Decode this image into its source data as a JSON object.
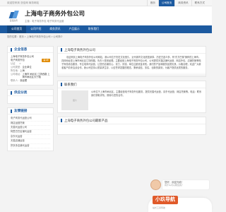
{
  "topbar": {
    "welcome": "欢迎您来到 亚佳网 商务网站",
    "links": [
      "首页",
      "公司首页",
      "商务资讯",
      "联系方式"
    ]
  },
  "header": {
    "logo_caption": "亚佳商务",
    "company_name": "上海电子商务外包公司",
    "company_sub": "主营：电子商务外包·电子商务代运营"
  },
  "nav": [
    "公司首页",
    "公司介绍",
    "商务资讯",
    "产品展示",
    "联系我们"
  ],
  "breadcrumb": "您的位置：首页 > 上海电子商务外包公司 > 公司简介",
  "sidebar": {
    "info_title": "企业信息",
    "info_rows": [
      {
        "k": "",
        "v": "上海电子商务外包公司"
      },
      {
        "k": "",
        "v": "电子商务外包",
        "badge": "第1年"
      },
      {
        "k": "认证",
        "v": "☆"
      },
      {
        "k": "公司类型：",
        "v": "企业单位"
      },
      {
        "k": "所在地：",
        "v": "上海"
      },
      {
        "k": "公司地址：",
        "v": "上海市 闸北区 江场西路 上海市闸北区大宁路"
      },
      {
        "k": "联系人：",
        "v": "张经理"
      }
    ],
    "recent_title": "供应分类",
    "news_title": "友情链接",
    "news": [
      "电子商务代运营公司",
      "网店运营托管",
      "天猫代运营公司",
      "阿里巴巴店铺代运营",
      "京东代运营",
      "天猫店铺运营",
      "拼多多店铺代运营"
    ]
  },
  "main": {
    "intro_title": "上海电子商务外包公司",
    "intro_text": "欢迎来到上海电子商务外包公司网站，我公司位于历史文化悠久、近代城市文化底蕴深厚、历史古迹众多，有“东方巴黎”美称的上海市。具体地址是上海市闸北区江场西路，负责人是张经理。主要经营上海电子商务外包公司，公司提供天猫店铺代运营、网店外包、店铺托管等电子商务综合服务，专注电商代运营，让您的店铺省心、省力、省钱。单位注册资金未知。我们的产品和服务品质优良，价格合理，欢迎广大新老客户前来洽谈合作。我公司坚持以质量求生存、以信誉求发展的理念，秉承诚信、务实、创新的原则，为客户提供优质的服务。",
    "contact_title": "联系我们",
    "contact_img": "图片",
    "contact_text": "公司位于上海市闸北区，主要经营电子商务外包服务，提供天猫代运营、京东代运营、网店托管等。电话：联系我们获取详情，期待与您的合作。",
    "products_title": "上海电子商务外包公司最新产品"
  },
  "banner": {
    "line1": "您好，欢迎光临！",
    "line2": "有什么可以帮您的？",
    "cta": "小玖导航",
    "cta_sub": "站长工具导航"
  }
}
